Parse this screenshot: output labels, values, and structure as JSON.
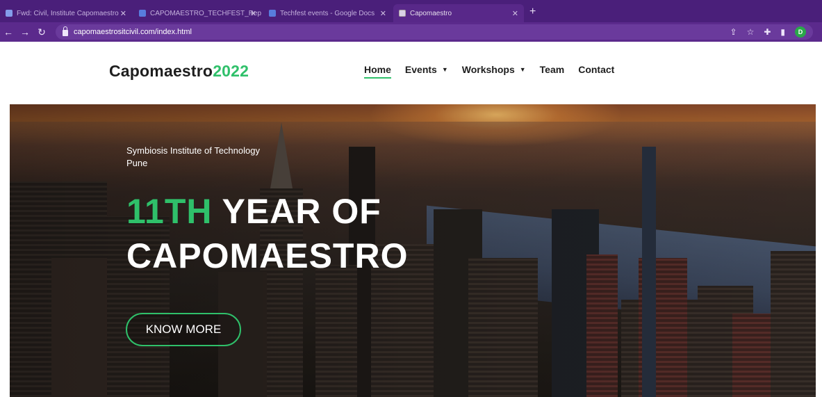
{
  "browser": {
    "tabs": [
      {
        "label": "Fwd: Civil, Institute Capomaestro"
      },
      {
        "label": "CAPOMAESTRO_TECHFEST_Rep"
      },
      {
        "label": "Techfest events - Google Docs"
      },
      {
        "label": "Capomaestro"
      }
    ],
    "address": "capomaestrositcivil.com/index.html",
    "profile_initial": "D"
  },
  "site": {
    "logo_text": "Capomaestro",
    "logo_year": "2022",
    "nav": [
      {
        "label": "Home"
      },
      {
        "label": "Events"
      },
      {
        "label": "Workshops"
      },
      {
        "label": "Team"
      },
      {
        "label": "Contact"
      }
    ]
  },
  "hero": {
    "institute_line1": "Symbiosis Institute of Technology",
    "institute_line2": "Pune",
    "headline_highlight": "11TH",
    "headline_rest_line1": "YEAR OF",
    "headline_line2": "CAPOMAESTRO",
    "cta_label": "KNOW MORE"
  },
  "colors": {
    "accent": "#2fc06a",
    "browser_frame": "#5b2a8c",
    "header_bg": "#ffffff",
    "text_dark": "#1e1e1e"
  }
}
